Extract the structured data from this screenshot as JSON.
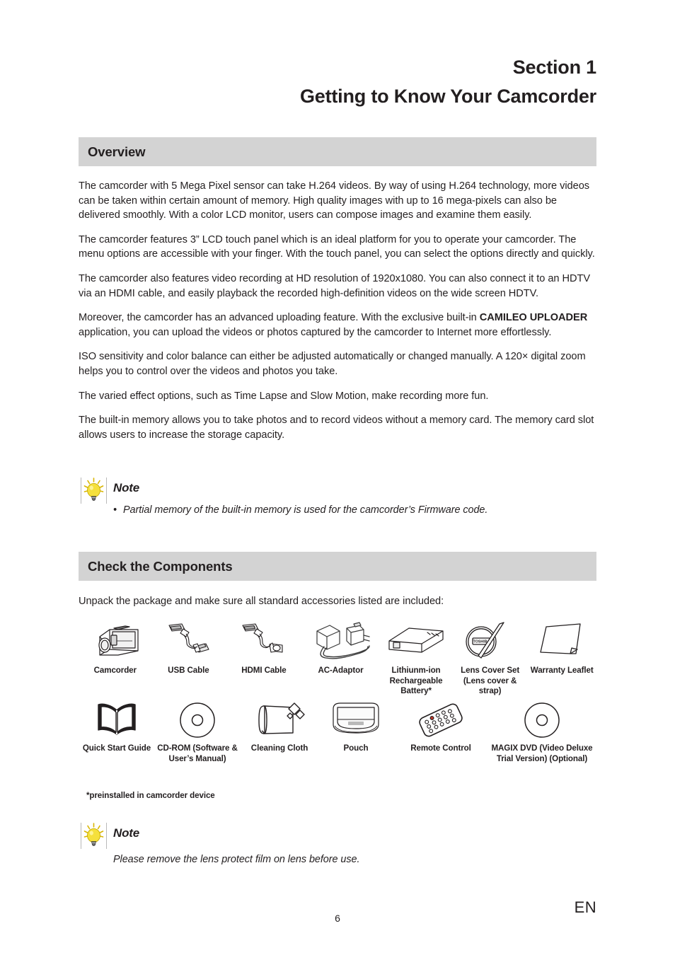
{
  "header": {
    "section_number": "Section 1",
    "section_title": "Getting to Know Your Camcorder"
  },
  "overview": {
    "bar_label": "Overview",
    "paragraphs": [
      "The camcorder with 5 Mega Pixel sensor can take H.264 videos. By way of using H.264 technology, more videos can be taken within certain amount of memory. High quality images with up to 16 mega-pixels can also be delivered smoothly. With a color LCD monitor, users can compose images and examine them easily.",
      "The camcorder features 3” LCD touch panel which is an ideal platform for you to operate your camcorder. The menu options are accessible with your finger. With the touch panel, you can select the options directly and quickly.",
      "The camcorder also features video recording at HD resolution of 1920x1080. You can also connect it to an HDTV via an HDMI cable, and easily playback the recorded high-definition videos on the wide screen HDTV."
    ],
    "paragraph_uploader_pre": "Moreover, the camcorder has an advanced uploading feature. With the exclusive built-in ",
    "paragraph_uploader_bold1": "CAMILEO UPLOADER",
    "paragraph_uploader_post": " application, you can upload the videos or photos captured by the camcorder to Internet more effortlessly.",
    "paragraphs_tail": [
      "ISO sensitivity and color balance can either be adjusted automatically or changed manually. A 120× digital zoom helps you to control over the videos and photos you take.",
      "The varied effect options, such as Time Lapse and Slow Motion, make recording more fun.",
      "The built-in memory allows you to take photos and to record videos without a memory card. The memory card slot allows users to increase the storage capacity."
    ],
    "note": {
      "title": "Note",
      "bullet": "•",
      "text": "Partial memory of the built-in memory is used for the camcorder’s Firmware code."
    }
  },
  "components": {
    "bar_label": "Check the Components",
    "intro": "Unpack the package and make sure all standard accessories listed are included:",
    "footnote": "*preinstalled in camcorder device",
    "row1": [
      {
        "icon": "camcorder-icon",
        "label": "Camcorder"
      },
      {
        "icon": "usb-cable-icon",
        "label": "USB Cable"
      },
      {
        "icon": "hdmi-cable-icon",
        "label": "HDMI Cable"
      },
      {
        "icon": "ac-adaptor-icon",
        "label": "AC-Adaptor"
      },
      {
        "icon": "battery-icon",
        "label": "Lithiunm-ion Rechargeable Battery*"
      },
      {
        "icon": "lens-cover-icon",
        "label": "Lens Cover Set (Lens cover & strap)"
      },
      {
        "icon": "warranty-leaflet-icon",
        "label": "Warranty Leaflet"
      }
    ],
    "row2": [
      {
        "icon": "quick-start-guide-icon",
        "label": "Quick Start Guide"
      },
      {
        "icon": "cd-rom-icon",
        "label": "CD-ROM (Software & User’s Manual)"
      },
      {
        "icon": "cleaning-cloth-icon",
        "label": "Cleaning Cloth"
      },
      {
        "icon": "pouch-icon",
        "label": "Pouch"
      },
      {
        "icon": "remote-control-icon",
        "label": "Remote Control"
      },
      {
        "icon": "magix-dvd-icon",
        "label": "MAGIX DVD (Video Deluxe Trial Version) (Optional)"
      }
    ],
    "brand_mark": "TOSHIBA",
    "note": {
      "title": "Note",
      "text": "Please remove the lens protect film on lens before use."
    }
  },
  "footer": {
    "page_number": "6",
    "language": "EN"
  },
  "colors": {
    "bar_background": "#d3d3d3",
    "text": "#231f20",
    "bulb_yellow": "#f5e03c",
    "line_art": "#231f20"
  }
}
